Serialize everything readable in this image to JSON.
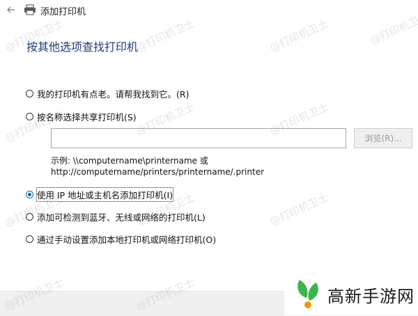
{
  "window": {
    "title": "添加打印机"
  },
  "heading": "按其他选项查找打印机",
  "options": [
    {
      "label": "我的打印机有点老。请帮我找到它。(R)",
      "selected": false
    },
    {
      "label": "按名称选择共享打印机(S)",
      "selected": false
    },
    {
      "label": "使用 IP 地址或主机名添加打印机(I)",
      "selected": true
    },
    {
      "label": "添加可检测到蓝牙、无线或网络的打印机(L)",
      "selected": false
    },
    {
      "label": "通过手动设置添加本地打印机或网络打印机(O)",
      "selected": false
    }
  ],
  "shared_printer": {
    "input_value": "",
    "browse_label": "浏览(R)...",
    "example_line1": "示例: \\\\computername\\printername 或",
    "example_line2": "http://computername/printers/printername/.printer"
  },
  "watermark": "@打印机卫士",
  "brand": {
    "text": "高新手游网",
    "green": "#3bb54a",
    "orange": "#f39800"
  },
  "colors": {
    "accent": "#0067c0",
    "heading": "#1f3b78"
  },
  "icons": {
    "back": "back-arrow-icon",
    "printer": "printer-icon",
    "brand": "leaf-logo-icon"
  }
}
